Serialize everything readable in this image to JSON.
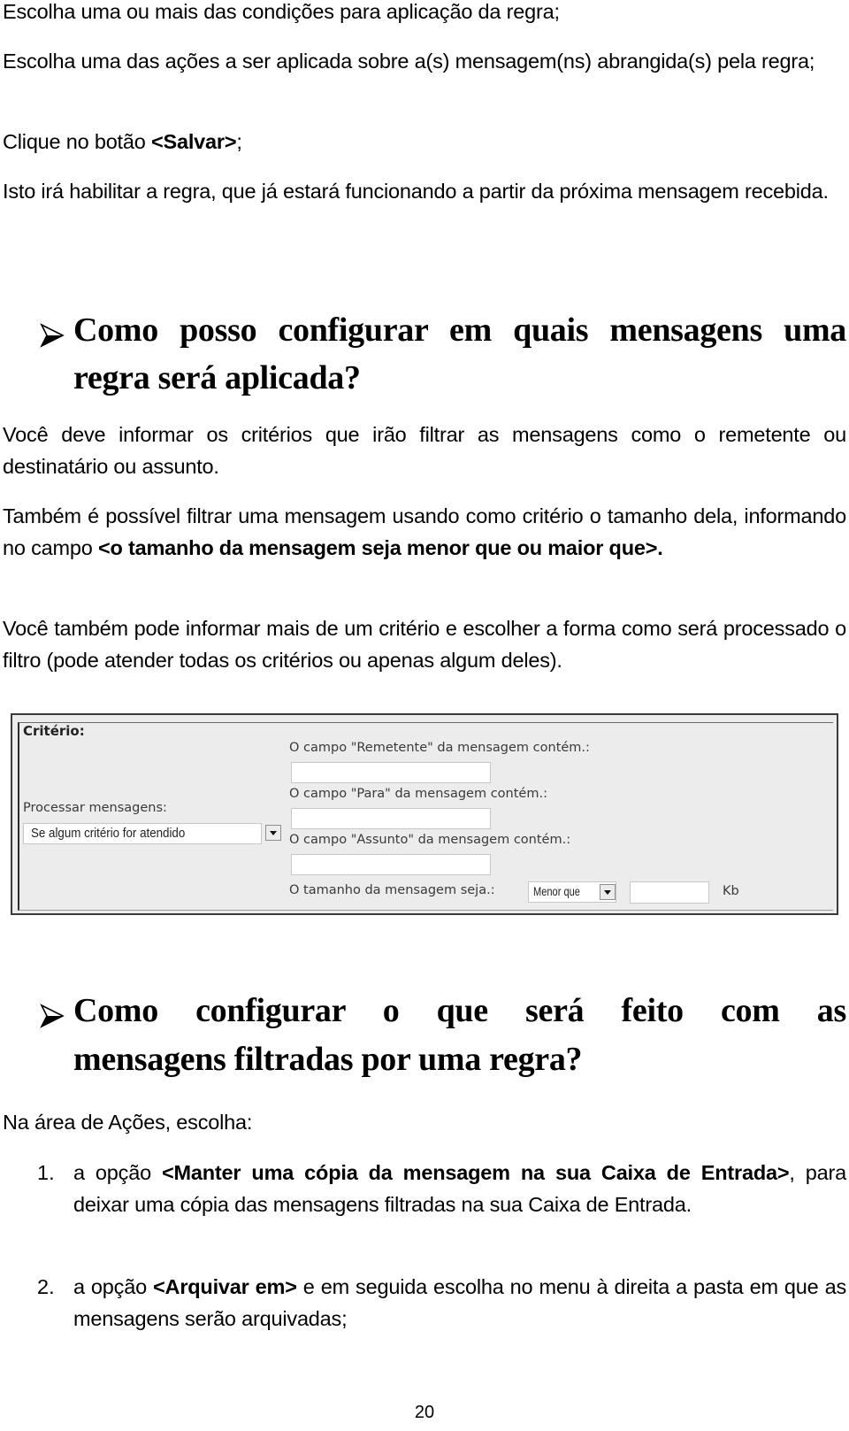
{
  "intro_paragraphs": [
    "Escolha uma ou mais das condições para aplicação da regra;",
    "Escolha uma das ações a ser aplicada sobre a(s) mensagem(ns) abrangida(s) pela regra;"
  ],
  "save_step": {
    "prefix": "Clique no botão ",
    "bold": "<Salvar>",
    "suffix": ";"
  },
  "enable_note": "Isto irá habilitar a regra, que já estará funcionando a partir da próxima mensagem recebida.",
  "section1": {
    "bullet_icon": "arrowhead-bullet-icon",
    "heading_line1": "Como posso configurar em quais mensagens uma",
    "heading_line2": "regra será aplicada?",
    "para1": "Você deve informar os critérios que irão filtrar as mensagens como o remetente ou destinatário ou assunto.",
    "para2_prefix": "Também é possível filtrar uma mensagem usando como critério o tamanho dela, informando no campo ",
    "para2_bold": "<o tamanho da mensagem seja  menor que ou maior que>.",
    "para3": "Você também pode informar mais de um critério e escolher a forma como será processado o filtro (pode atender todas os critérios ou apenas algum deles)."
  },
  "criteria_panel": {
    "title": "Critério:",
    "process_label": "Processar mensagens:",
    "process_select_value": "Se algum critério for atendido",
    "sender_label": "O campo \"Remetente\" da mensagem contém.:",
    "sender_value": "",
    "to_label": "O campo \"Para\" da mensagem contém.:",
    "to_value": "",
    "subject_label": "O campo \"Assunto\" da mensagem contém.:",
    "subject_value": "",
    "size_label": "O tamanho da mensagem seja.:",
    "size_select_value": "Menor que",
    "size_value": "",
    "size_unit": "Kb"
  },
  "section2": {
    "bullet_icon": "arrowhead-bullet-icon",
    "heading_line1": "Como configurar o que será feito com as",
    "heading_line2": "mensagens filtradas por uma regra?",
    "intro": "Na área de Ações, escolha:",
    "items": [
      {
        "number": "1.",
        "prefix": "a opção ",
        "bold": "<Manter uma cópia da mensagem na sua Caixa de Entrada>",
        "suffix": ", para deixar uma cópia das mensagens filtradas na sua Caixa de Entrada."
      },
      {
        "number": "2.",
        "prefix": "a opção ",
        "bold": "<Arquivar em>",
        "suffix": " e em seguida escolha no menu à direita a pasta em que as mensagens serão arquivadas;"
      }
    ]
  },
  "page_number": "20"
}
